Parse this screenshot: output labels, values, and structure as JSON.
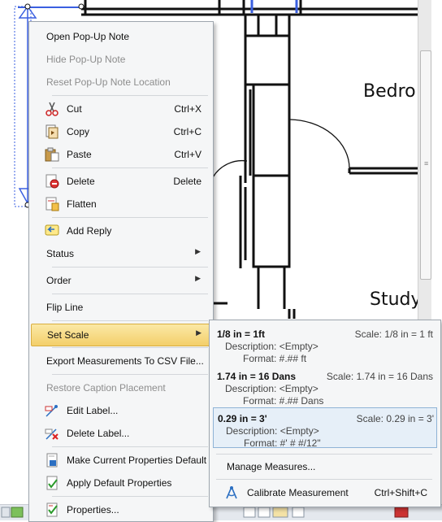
{
  "canvas": {
    "room_labels": [
      "Bedro",
      "Study"
    ]
  },
  "context_menu": {
    "items": [
      {
        "label": "Open Pop-Up Note"
      },
      {
        "label": "Hide Pop-Up Note"
      },
      {
        "label": "Reset Pop-Up Note Location"
      },
      {
        "label": "Cut",
        "shortcut": "Ctrl+X",
        "icon": "scissors-icon"
      },
      {
        "label": "Copy",
        "shortcut": "Ctrl+C",
        "icon": "copy-icon"
      },
      {
        "label": "Paste",
        "shortcut": "Ctrl+V",
        "icon": "paste-icon"
      },
      {
        "label": "Delete",
        "shortcut": "Delete",
        "icon": "delete-icon"
      },
      {
        "label": "Flatten",
        "icon": "flatten-icon"
      },
      {
        "label": "Add Reply",
        "icon": "reply-icon"
      },
      {
        "label": "Status",
        "submenu": true
      },
      {
        "label": "Order",
        "submenu": true
      },
      {
        "label": "Flip Line"
      },
      {
        "label": "Set Scale",
        "submenu": true,
        "highlighted": true
      },
      {
        "label": "Export Measurements To CSV File..."
      },
      {
        "label": "Restore Caption Placement"
      },
      {
        "label": "Edit Label...",
        "icon": "edit-label-icon"
      },
      {
        "label": "Delete Label...",
        "icon": "delete-label-icon"
      },
      {
        "label": "Make Current Properties Default",
        "icon": "make-default-icon"
      },
      {
        "label": "Apply Default Properties",
        "icon": "apply-default-icon"
      },
      {
        "label": "Properties...",
        "icon": "properties-icon"
      }
    ]
  },
  "scale_submenu": {
    "scales": [
      {
        "name": "1/8 in = 1ft",
        "scale_text": "Scale: 1/8 in = 1 ft",
        "description": "Description: <Empty>",
        "format": "Format: #.## ft"
      },
      {
        "name": "1.74 in = 16 Dans",
        "scale_text": "Scale: 1.74 in = 16 Dans",
        "description": "Description: <Empty>",
        "format": "Format: #.## Dans"
      },
      {
        "name": "0.29 in = 3'",
        "scale_text": "Scale: 0.29 in = 3'",
        "description": "Description: <Empty>",
        "format": "Format: #' # #/12\""
      }
    ],
    "manage_label": "Manage Measures...",
    "calibrate_label": "Calibrate Measurement",
    "calibrate_shortcut": "Ctrl+Shift+C"
  },
  "colors": {
    "highlight": "#f3cf6a",
    "selection": "#e6eff8",
    "annotation_blue": "#3a5fe0"
  }
}
